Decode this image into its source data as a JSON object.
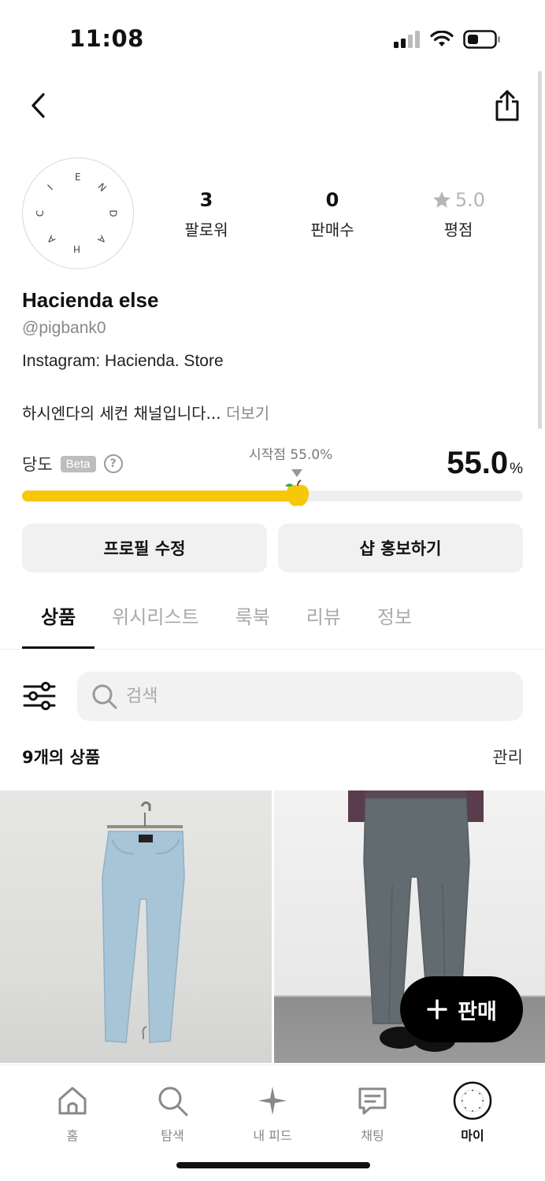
{
  "status": {
    "time": "11:08"
  },
  "profile": {
    "avatar_letters": [
      "E",
      "N",
      "D",
      "A",
      "H",
      "A",
      "C",
      "I"
    ],
    "name": "Hacienda else",
    "handle": "@pigbank0",
    "bio_line1": "Instagram: Hacienda. Store",
    "bio_line2": "하시엔다의 세컨 채널입니다...",
    "more": "더보기"
  },
  "stats": {
    "followers": {
      "value": "3",
      "label": "팔로워"
    },
    "sales": {
      "value": "0",
      "label": "판매수"
    },
    "rating": {
      "value": "5.0",
      "label": "평점"
    }
  },
  "sweetness": {
    "label": "당도",
    "badge": "Beta",
    "help": "?",
    "start_text": "시작점 55.0%",
    "value": "55.0",
    "unit": "%",
    "fraction": 0.55,
    "colors": {
      "fill": "#f7c80a",
      "track": "#efefef"
    }
  },
  "actions": {
    "edit_profile": "프로필 수정",
    "promote_shop": "샵 홍보하기"
  },
  "tabs": [
    {
      "label": "상품",
      "active": true
    },
    {
      "label": "위시리스트",
      "active": false
    },
    {
      "label": "룩북",
      "active": false
    },
    {
      "label": "리뷰",
      "active": false
    },
    {
      "label": "정보",
      "active": false
    }
  ],
  "search": {
    "placeholder": "검색"
  },
  "products": {
    "count_bold": "9개의 상품",
    "manage": "관리"
  },
  "fab": {
    "label": "판매"
  },
  "bottom_nav": [
    {
      "label": "홈",
      "icon": "home-icon"
    },
    {
      "label": "탐색",
      "icon": "search-icon"
    },
    {
      "label": "내 피드",
      "icon": "sparkle-icon"
    },
    {
      "label": "채팅",
      "icon": "chat-icon"
    },
    {
      "label": "마이",
      "icon": "avatar-icon"
    }
  ]
}
